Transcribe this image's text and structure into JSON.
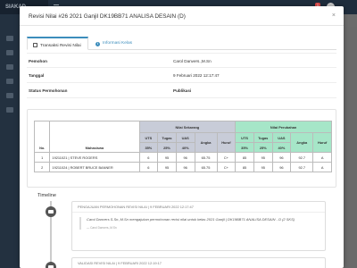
{
  "app": {
    "brand": "SIAKAD",
    "notification_count": "1"
  },
  "modal": {
    "title": "Revisi Nilai #26 2021 Ganjil DK19BB71 ANALISA DESAIN (D)",
    "close_label": "×"
  },
  "tabs": [
    {
      "label": "Transaksi Revisi Nilai",
      "icon": "edit-icon",
      "active": true
    },
    {
      "label": "Informasi Kelas",
      "icon": "info-icon",
      "active": false
    }
  ],
  "info": [
    {
      "label": "Pemohon",
      "value": "Carol Danvers.,M.Sn"
    },
    {
      "label": "Tanggal",
      "value": "9 Februari 2022 12:17:47"
    },
    {
      "label": "Status Permohonan",
      "value": "Publikasi"
    }
  ],
  "grades": {
    "group_now": "Nilai Sekarang",
    "group_new": "Nilai Perubahan",
    "col_no": "No.",
    "col_student": "Mahasiswa",
    "sub_headers": [
      "UTS",
      "Tugas",
      "UAS",
      "",
      ""
    ],
    "sub_headers_now": [
      "UTS",
      "Tugas",
      "UAS",
      "",
      ""
    ],
    "pct_now": [
      "35%",
      "25%",
      "40%",
      "Angka",
      "Huruf"
    ],
    "pct_new": [
      "35%",
      "25%",
      "40%",
      "Angka",
      "Huruf"
    ],
    "rows": [
      {
        "no": "1",
        "student": "19211021 | STEVE ROGERS",
        "now": [
          "6",
          "95",
          "96",
          "65.75",
          "C+"
        ],
        "new": [
          "85",
          "95",
          "96",
          "92.7",
          "A"
        ]
      },
      {
        "no": "2",
        "student": "19211024 | ROBERT BRUCE BANNER",
        "now": [
          "6",
          "95",
          "96",
          "65.75",
          "C+"
        ],
        "new": [
          "85",
          "95",
          "96",
          "92.7",
          "A"
        ]
      }
    ]
  },
  "timeline": {
    "title": "Timeline",
    "items": [
      {
        "header": "PENGAJUAN PERMOHONAN REVISI NILAI | 9 FEBRUARI 2022 12:17:47",
        "quote": "Carol Danvers S.Sn.,M.Sn mengajukan permohonan revisi nilai untuk kelas 2021 Ganjil | DK19BB71 ANALISA DESAIN - D (2 SKS)",
        "author": "— Carol Danvers.,M.Sn"
      },
      {
        "header": "VALIDASI REVISI NILAI | 9 FEBRUARI 2022 12:19:17"
      }
    ]
  }
}
